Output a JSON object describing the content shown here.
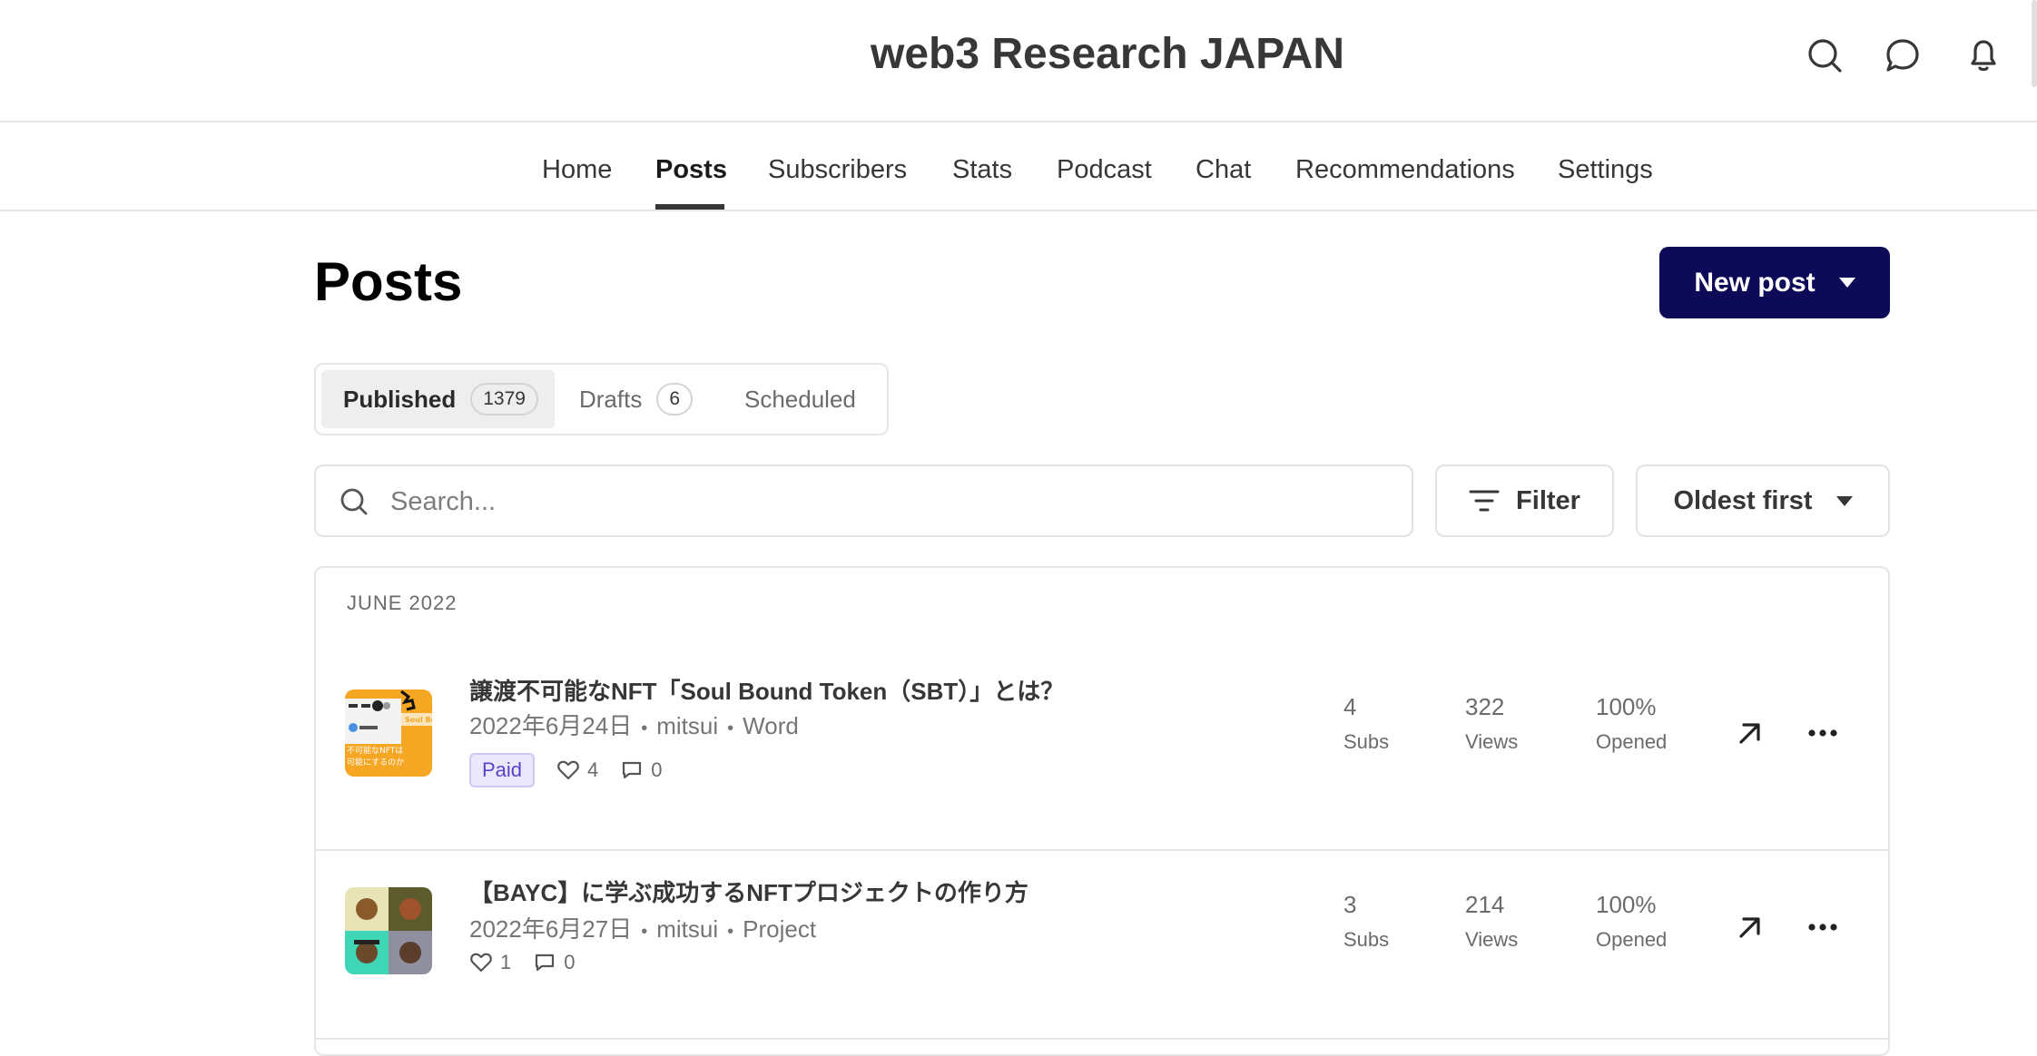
{
  "header": {
    "title": "web3 Research JAPAN",
    "icons": [
      "search-icon",
      "chat-icon",
      "bell-icon"
    ]
  },
  "nav": {
    "items": [
      "Home",
      "Posts",
      "Subscribers",
      "Stats",
      "Podcast",
      "Chat",
      "Recommendations",
      "Settings"
    ],
    "active": "Posts"
  },
  "page": {
    "title": "Posts",
    "new_post_label": "New post"
  },
  "tabs": [
    {
      "label": "Published",
      "count": "1379"
    },
    {
      "label": "Drafts",
      "count": "6"
    },
    {
      "label": "Scheduled"
    }
  ],
  "search": {
    "placeholder": "Search..."
  },
  "filter_label": "Filter",
  "sort_label": "Oldest first",
  "list": {
    "month": "JUNE 2022",
    "posts": [
      {
        "title": "譲渡不可能なNFT「Soul Bound Token（SBT）」とは？",
        "date": "2022年6月24日",
        "author": "mitsui",
        "section": "Word",
        "badge": "Paid",
        "likes": "4",
        "comments": "0",
        "subs": "4",
        "subs_label": "Subs",
        "views": "322",
        "views_label": "Views",
        "opened": "100%",
        "opened_label": "Opened",
        "thumb_text": [
          "Soul Bound",
          "不可能なNFTは",
          "可能にするのか"
        ]
      },
      {
        "title": "【BAYC】に学ぶ成功するNFTプロジェクトの作り方",
        "date": "2022年6月27日",
        "author": "mitsui",
        "section": "Project",
        "likes": "1",
        "comments": "0",
        "subs": "3",
        "subs_label": "Subs",
        "views": "214",
        "views_label": "Views",
        "opened": "100%",
        "opened_label": "Opened"
      }
    ]
  },
  "colors": {
    "accent": "#0d0a57",
    "paid_bg": "#ebe8fc",
    "paid_text": "#5b41c9"
  }
}
